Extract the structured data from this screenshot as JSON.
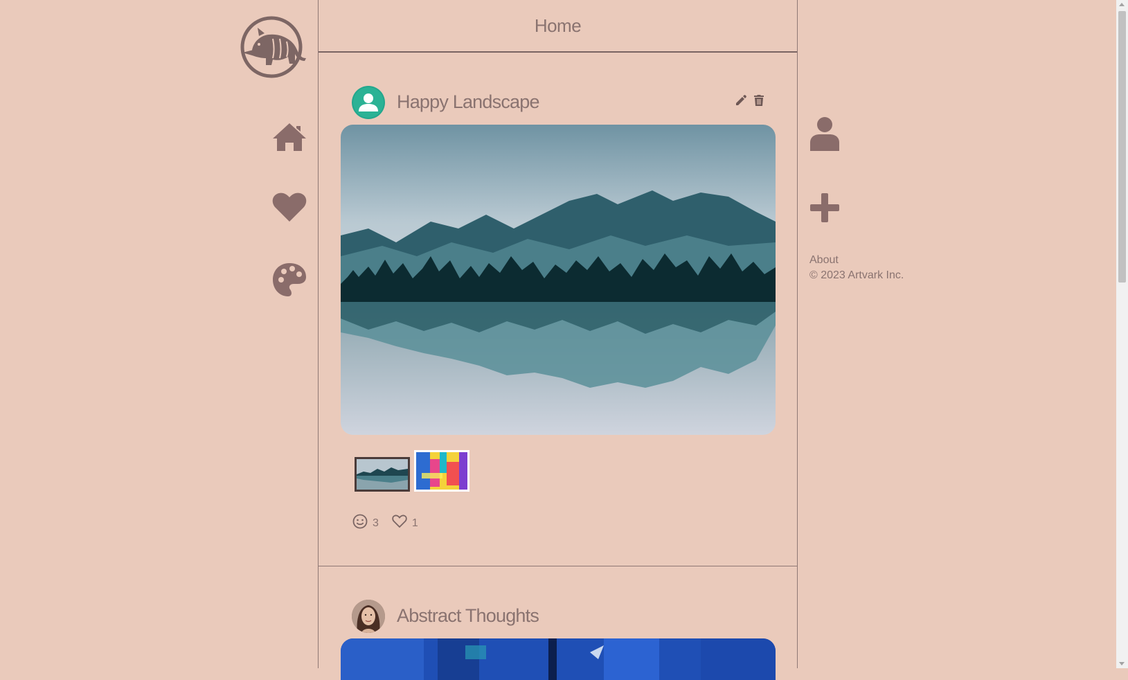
{
  "header": {
    "title": "Home"
  },
  "nav": {
    "items": [
      {
        "icon": "home-icon"
      },
      {
        "icon": "heart-icon"
      },
      {
        "icon": "palette-icon"
      }
    ]
  },
  "posts": [
    {
      "title": "Happy Landscape",
      "reactions": {
        "smile_count": "3",
        "heart_count": "1"
      },
      "actions": [
        "pencil-icon",
        "trash-icon"
      ],
      "thumbnails": [
        "landscape",
        "abstract-colorful"
      ]
    },
    {
      "title": "Abstract Thoughts"
    }
  ],
  "right": {
    "icons": [
      "user-icon",
      "plus-icon"
    ],
    "about_label": "About",
    "copyright": "© 2023 Artvark Inc."
  },
  "colors": {
    "background": "#eacabb",
    "text": "#8a7370",
    "icon": "#8a6c6a"
  }
}
